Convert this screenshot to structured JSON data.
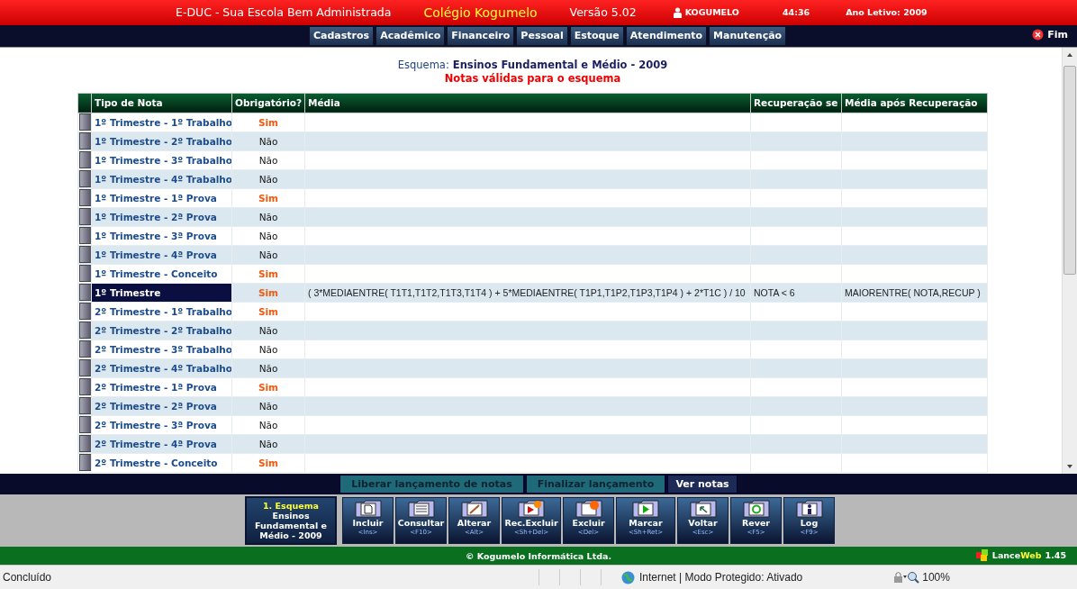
{
  "top_bar": {
    "app": "E-DUC - Sua Escola Bem Administrada",
    "school": "Colégio Kogumelo",
    "version": "Versão 5.02",
    "user": "KOGUMELO",
    "time": "44:36",
    "year": "Ano Letivo: 2009"
  },
  "menu": [
    "Cadastros",
    "Acadêmico",
    "Financeiro",
    "Pessoal",
    "Estoque",
    "Atendimento",
    "Manutenção"
  ],
  "exit": "Fim",
  "scheme_label": "Esquema:",
  "scheme_name": "Ensinos Fundamental e Médio - 2009",
  "subtitle": "Notas válidas para o esquema",
  "table": {
    "columns": [
      "Tipo de Nota",
      "Obrigatório?",
      "Média",
      "Recuperação se",
      "Média após Recuperação"
    ],
    "rows": [
      {
        "type": "1º Trimestre - 1º Trabalho",
        "required": true,
        "obrig": "Sim",
        "selected": false
      },
      {
        "type": "1º Trimestre - 2º Trabalho",
        "required": false,
        "obrig": "Não",
        "selected": false
      },
      {
        "type": "1º Trimestre - 3º Trabalho",
        "required": false,
        "obrig": "Não",
        "selected": false
      },
      {
        "type": "1º Trimestre - 4º Trabalho",
        "required": false,
        "obrig": "Não",
        "selected": false
      },
      {
        "type": "1º Trimestre - 1ª Prova",
        "required": true,
        "obrig": "Sim",
        "selected": false
      },
      {
        "type": "1º Trimestre - 2ª Prova",
        "required": false,
        "obrig": "Não",
        "selected": false
      },
      {
        "type": "1º Trimestre - 3ª Prova",
        "required": false,
        "obrig": "Não",
        "selected": false
      },
      {
        "type": "1º Trimestre - 4ª Prova",
        "required": false,
        "obrig": "Não",
        "selected": false
      },
      {
        "type": "1º Trimestre - Conceito",
        "required": true,
        "obrig": "Sim",
        "selected": false
      },
      {
        "type": "1º Trimestre",
        "required": true,
        "obrig": "Sim",
        "selected": true,
        "media": "( 3*MEDIAENTRE( T1T1,T1T2,T1T3,T1T4 ) + 5*MEDIAENTRE( T1P1,T1P2,T1P3,T1P4 ) + 2*T1C ) / 10",
        "recovery_if": "NOTA < 6",
        "after": "MAIORENTRE( NOTA,RECUP )"
      },
      {
        "type": "2º Trimestre - 1º Trabalho",
        "required": true,
        "obrig": "Sim",
        "selected": false
      },
      {
        "type": "2º Trimestre - 2º Trabalho",
        "required": false,
        "obrig": "Não",
        "selected": false
      },
      {
        "type": "2º Trimestre - 3º Trabalho",
        "required": false,
        "obrig": "Não",
        "selected": false
      },
      {
        "type": "2º Trimestre - 4º Trabalho",
        "required": false,
        "obrig": "Não",
        "selected": false
      },
      {
        "type": "2º Trimestre - 1ª Prova",
        "required": true,
        "obrig": "Sim",
        "selected": false
      },
      {
        "type": "2º Trimestre - 2ª Prova",
        "required": false,
        "obrig": "Não",
        "selected": false
      },
      {
        "type": "2º Trimestre - 3ª Prova",
        "required": false,
        "obrig": "Não",
        "selected": false
      },
      {
        "type": "2º Trimestre - 4ª Prova",
        "required": false,
        "obrig": "Não",
        "selected": false
      },
      {
        "type": "2º Trimestre - Conceito",
        "required": true,
        "obrig": "Sim",
        "selected": false
      }
    ]
  },
  "actions": [
    {
      "label": "Liberar lançamento de notas",
      "selected": false
    },
    {
      "label": "Finalizar lançamento",
      "selected": false
    },
    {
      "label": "Ver notas",
      "selected": true
    }
  ],
  "context": {
    "title": "1. Esquema",
    "text": "Ensinos Fundamental e Médio - 2009"
  },
  "tools": [
    {
      "label": "Incluir",
      "key": "<Ins>",
      "kind": "page"
    },
    {
      "label": "Consultar",
      "key": "<F10>",
      "kind": "list"
    },
    {
      "label": "Alterar",
      "key": "<Alt>",
      "kind": "pencil"
    },
    {
      "label": "Rec.Excluir",
      "key": "<Sh+Del>",
      "kind": "play-fire"
    },
    {
      "label": "Excluir",
      "key": "<Del>",
      "kind": "fire"
    },
    {
      "label": "Marcar",
      "key": "<Sh+Ret>",
      "kind": "play"
    },
    {
      "label": "Voltar",
      "key": "<Esc>",
      "kind": "back"
    },
    {
      "label": "Rever",
      "key": "<F5>",
      "kind": "refresh"
    },
    {
      "label": "Log",
      "key": "<F9>",
      "kind": "person"
    }
  ],
  "footer": {
    "copyright": "© Kogumelo Informática Ltda.",
    "brand_a": "Lance",
    "brand_b": "Web",
    "brand_version": "1.45"
  },
  "status_bar": {
    "status": "Concluído",
    "zone": "Internet | Modo Protegido: Ativado",
    "zoom": "100%"
  }
}
